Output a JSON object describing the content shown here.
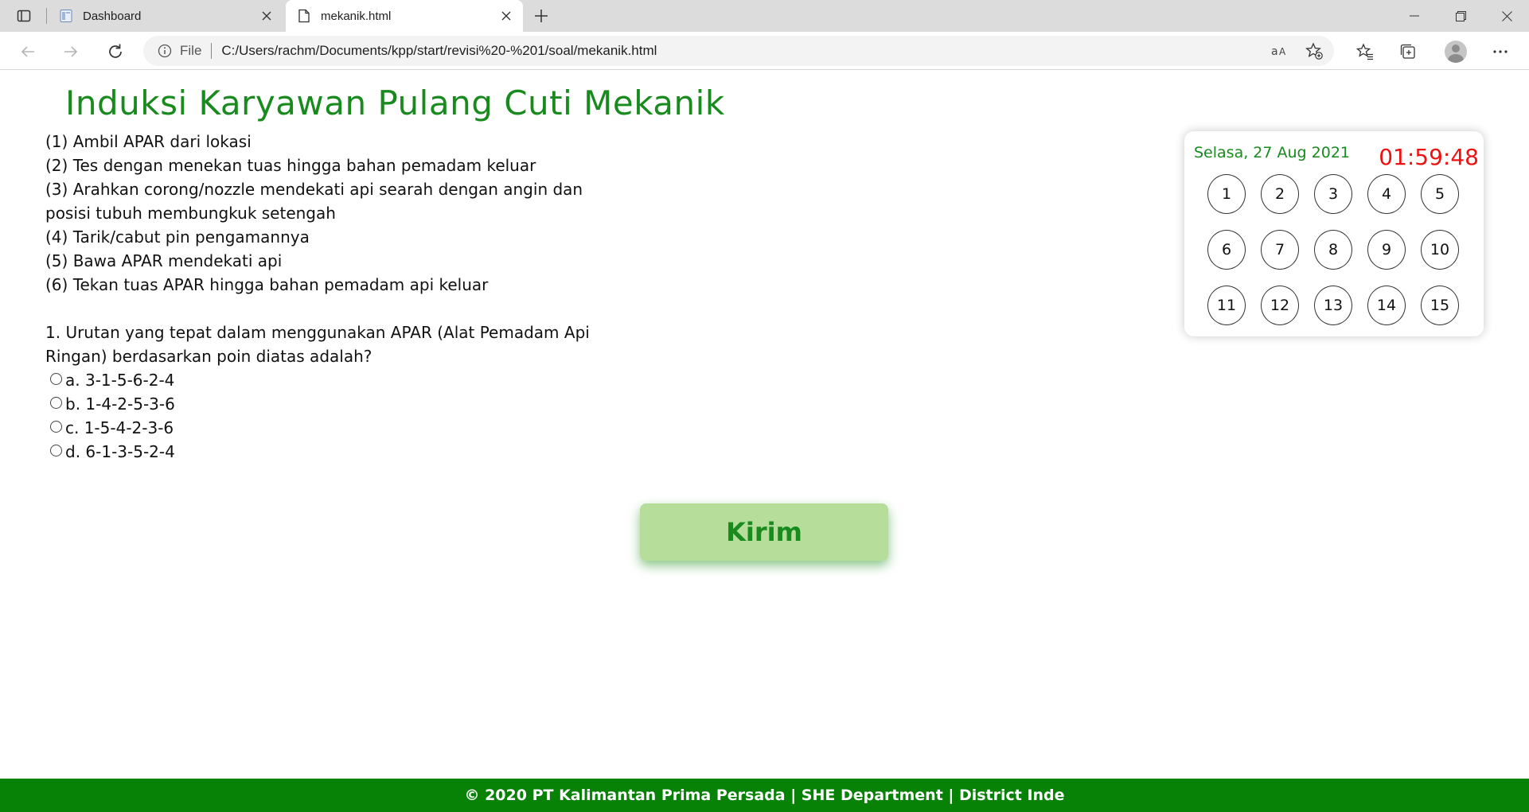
{
  "browser": {
    "tabs": [
      {
        "title": "Dashboard",
        "active": false
      },
      {
        "title": "mekanik.html",
        "active": true
      }
    ],
    "address": {
      "scheme_label": "File",
      "url": "C:/Users/rachm/Documents/kpp/start/revisi%20-%201/soal/mekanik.html"
    }
  },
  "page": {
    "title": "Induksi Karyawan Pulang Cuti Mekanik",
    "instructions": [
      "(1) Ambil APAR dari lokasi",
      "(2) Tes dengan menekan tuas hingga bahan pemadam keluar",
      "(3) Arahkan corong/nozzle mendekati api searah dengan angin dan posisi tubuh membungkuk setengah",
      "(4) Tarik/cabut pin pengamannya",
      "(5) Bawa APAR mendekati api",
      "(6) Tekan tuas APAR hingga bahan pemadam api keluar"
    ],
    "question": "1. Urutan yang tepat dalam menggunakan APAR (Alat Pemadam Api Ringan) berdasarkan poin diatas adalah?",
    "options": [
      "a. 3-1-5-6-2-4",
      "b. 1-4-2-5-3-6",
      "c. 1-5-4-2-3-6",
      "d. 6-1-3-5-2-4"
    ],
    "submit_label": "Kirim"
  },
  "panel": {
    "date": "Selasa, 27 Aug 2021",
    "timer": "01:59:48",
    "question_numbers": [
      "1",
      "2",
      "3",
      "4",
      "5",
      "6",
      "7",
      "8",
      "9",
      "10",
      "11",
      "12",
      "13",
      "14",
      "15"
    ]
  },
  "footer": {
    "text": "© 2020 PT Kalimantan Prima Persada | SHE Department | District Inde"
  },
  "colors": {
    "brand_green": "#188a1e",
    "footer_green": "#078207",
    "button_bg": "#b6de9a",
    "timer_red": "#ee1111"
  }
}
